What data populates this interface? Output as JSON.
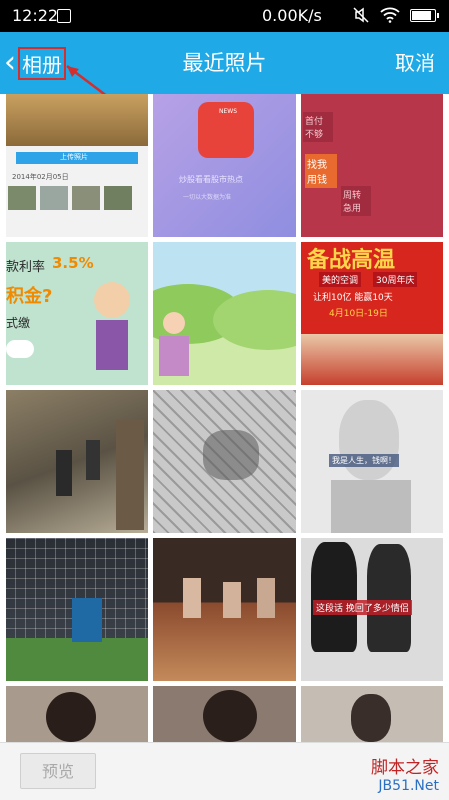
{
  "status_bar": {
    "time": "12:22",
    "network_speed": "0.00K/s"
  },
  "header": {
    "back_label": "相册",
    "title": "最近照片",
    "cancel_label": "取消"
  },
  "photos": [
    {
      "name": "photo-1",
      "labels": [
        "上传照片",
        "2014年02月05日"
      ]
    },
    {
      "name": "photo-2",
      "labels": [
        "NEWS",
        "炒股看看股市热点",
        "一切以大数据为准"
      ]
    },
    {
      "name": "photo-3",
      "labels": [
        "首付不够",
        "找我用钱",
        "周转急用"
      ]
    },
    {
      "name": "photo-4",
      "labels": [
        "款利率",
        "3.5%",
        "积金?",
        "式缴"
      ]
    },
    {
      "name": "photo-5",
      "labels": []
    },
    {
      "name": "photo-6",
      "labels": [
        "备战高温",
        "美的空调",
        "30周年庆",
        "让利10亿 能赢10天",
        "4月10日-19日"
      ]
    },
    {
      "name": "photo-7",
      "labels": []
    },
    {
      "name": "photo-8",
      "labels": []
    },
    {
      "name": "photo-9",
      "labels": [
        "我是人生，钱啊！"
      ]
    },
    {
      "name": "photo-10",
      "labels": []
    },
    {
      "name": "photo-11",
      "labels": []
    },
    {
      "name": "photo-12",
      "labels": [
        "这段话  挽回了多少情侣"
      ]
    },
    {
      "name": "photo-13",
      "labels": []
    },
    {
      "name": "photo-14",
      "labels": []
    },
    {
      "name": "photo-15",
      "labels": []
    }
  ],
  "bottom_bar": {
    "preview_label": "预览",
    "watermark_line1": "脚本之家",
    "watermark_line2": "JB51.Net"
  },
  "colors": {
    "header": "#1fa9e6",
    "annotation": "#d32f2f"
  }
}
